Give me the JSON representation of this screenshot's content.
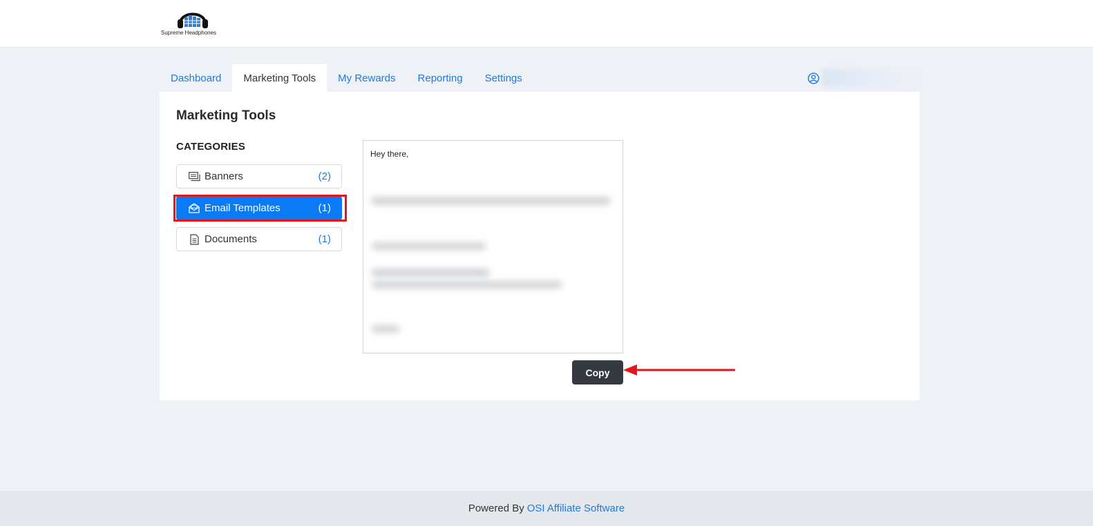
{
  "brand": {
    "logo_text": "Supreme Headphones"
  },
  "nav": {
    "tabs": [
      {
        "label": "Dashboard"
      },
      {
        "label": "Marketing Tools"
      },
      {
        "label": "My Rewards"
      },
      {
        "label": "Reporting"
      },
      {
        "label": "Settings"
      }
    ],
    "active_tab": "Marketing Tools",
    "account_icon": "user-circle-icon"
  },
  "main": {
    "title": "Marketing Tools",
    "categories_heading": "CATEGORIES",
    "categories": [
      {
        "label": "Banners",
        "count": "(2)",
        "icon": "banners-icon"
      },
      {
        "label": "Email Templates",
        "count": "(1)",
        "icon": "email-open-icon",
        "active": true
      },
      {
        "label": "Documents",
        "count": "(1)",
        "icon": "document-icon"
      }
    ],
    "template": {
      "greeting": "Hey there,"
    },
    "copy_label": "Copy"
  },
  "footer": {
    "prefix": "Powered By",
    "link_text": "OSI Affiliate Software"
  },
  "colors": {
    "accent": "#0a7bf4",
    "link": "#1f7ae0",
    "highlight": "#e8141b",
    "button": "#343a40"
  }
}
